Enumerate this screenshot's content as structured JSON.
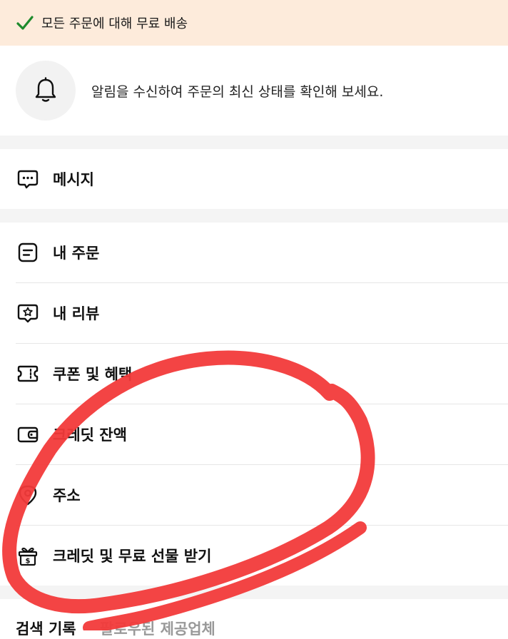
{
  "banner": {
    "text": "모든 주문에 대해 무료 배송",
    "icon": "check-icon",
    "check_color": "#1e8a2c"
  },
  "notification": {
    "text": "알림을 수신하여 주문의 최신 상태를 확인해 보세요.",
    "icon": "bell-icon"
  },
  "messages": {
    "label": "메시지",
    "icon": "message-icon"
  },
  "menu": [
    {
      "label": "내 주문",
      "icon": "orders-icon"
    },
    {
      "label": "내 리뷰",
      "icon": "review-icon"
    },
    {
      "label": "쿠폰 및 혜택",
      "icon": "coupon-icon"
    },
    {
      "label": "크레딧 잔액",
      "icon": "wallet-icon"
    },
    {
      "label": "주소",
      "icon": "location-icon"
    },
    {
      "label": "크레딧 및 무료 선물 받기",
      "icon": "gift-icon"
    }
  ],
  "bottom": {
    "label": "검색 기록",
    "label2": "팔로우된 제공업체"
  },
  "annotation_color": "#f23a3a"
}
